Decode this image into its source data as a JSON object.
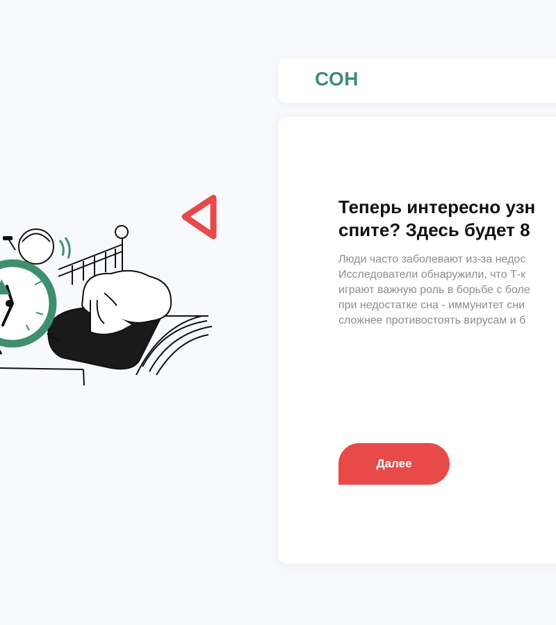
{
  "header": {
    "title": "СОН"
  },
  "question": {
    "title": "Теперь интересно узн\nспите? Здесь будет 8",
    "text": "Люди часто заболевают из-за недос\nИсследователи обнаружили, что Т-к\nиграют важную роль в борьбе с боле\nпри недостатке сна - иммунитет сни\nсложнее противостоять вирусам и б"
  },
  "actions": {
    "next_label": "Далее"
  },
  "illustration": {
    "icons": [
      "alarm-clock-icon",
      "bed-icon",
      "sleeping-person-icon",
      "triangle-icon"
    ]
  },
  "colors": {
    "brand_green": "#3d8f6e",
    "accent_red": "#e84a4a",
    "background": "#f7f9fc",
    "text_muted": "#8a8d92"
  }
}
